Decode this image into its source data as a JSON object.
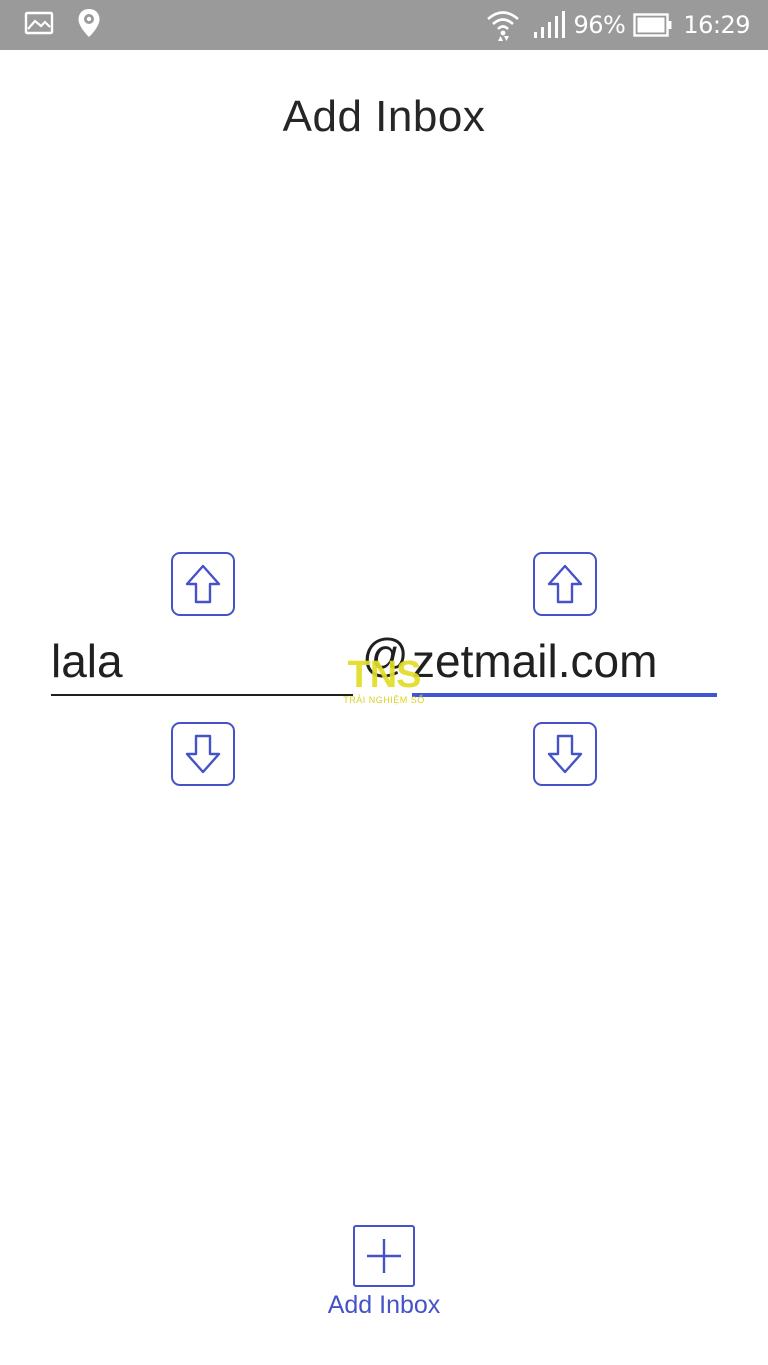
{
  "status_bar": {
    "battery_percent": "96%",
    "time": "16:29",
    "icons": [
      "gallery-icon",
      "location-icon",
      "wifi-icon",
      "signal-icon",
      "battery-icon"
    ]
  },
  "page": {
    "title": "Add Inbox"
  },
  "form": {
    "username_value": "lala",
    "at_symbol": "@",
    "domain_value": "zetmail.com"
  },
  "watermark": {
    "logo_text": "TNS",
    "tagline": "TRẢI NGHIỆM SỐ"
  },
  "actions": {
    "add_inbox_label": "Add Inbox"
  },
  "colors": {
    "accent": "#4653c8",
    "active_underline": "#3d56d8",
    "status_bar_bg": "#9a9a9a",
    "watermark": "#e2dd25"
  }
}
